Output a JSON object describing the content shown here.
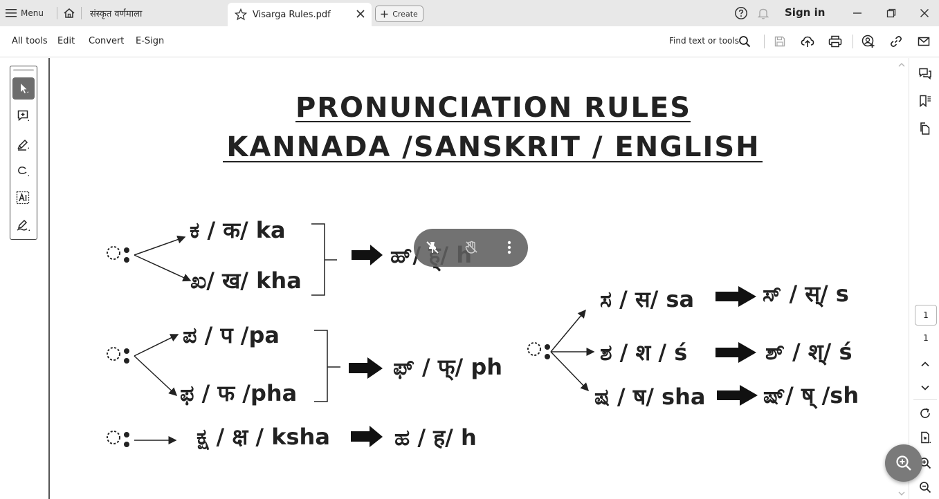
{
  "titlebar": {
    "menu_label": "Menu",
    "tab_inactive_label": "संस्कृत वर्णमाला",
    "tab_active_label": "Visarga Rules.pdf",
    "create_label": "Create",
    "signin_label": "Sign in"
  },
  "toolbar": {
    "all_tools": "All tools",
    "edit": "Edit",
    "convert": "Convert",
    "esign": "E-Sign",
    "find_label": "Find text or tools"
  },
  "document": {
    "title_line1": "PRONUNCIATION RULES",
    "title_line2": "KANNADA /SANSKRIT / ENGLISH",
    "rules": {
      "ka": "ಕ / क/ ka",
      "kha": "ಖ/ ख/ kha",
      "result_h1": "ಹ್/ ह्/ h",
      "pa": "ಪ / प /pa",
      "pha": "ಫ / फ /pha",
      "result_ph": "ಫ್ / फ्/ ph",
      "ksha": "ಕ್ಷ / क्ष / ksha",
      "result_h2": "ಹ / ह/ h",
      "sa": "ಸ / स/ sa",
      "result_s": "ಸ್ / स्/ s",
      "sha1": "ಶ / श / ś",
      "result_sha1": "ಶ್ / श्/ ś",
      "sha2": "ಷ / ष/ sha",
      "result_sh": "ಷ್/ ष् /sh"
    }
  },
  "pagination": {
    "current_page": "1",
    "total_pages": "1"
  },
  "colors": {
    "titlebar_bg": "#e8e8e8",
    "overlay_bg": "#5f5f5f",
    "active_tool_bg": "#6d6d6d"
  }
}
